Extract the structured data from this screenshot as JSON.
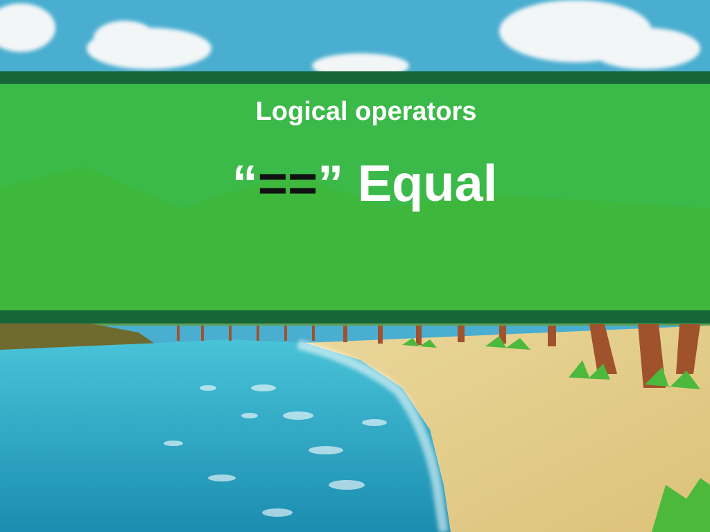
{
  "slide": {
    "subtitle": "Logical operators",
    "quote_open": "“",
    "operator": "==",
    "quote_close": "”",
    "operator_name": " Equal"
  },
  "colors": {
    "banner_green": "#3aba3a",
    "banner_stripe": "#17663a",
    "text_white": "#ffffff",
    "operator_black": "#111111",
    "sky": "#4aaed0",
    "sand": "#e6cf8a",
    "sea": "#2a9fc2"
  },
  "background": {
    "scene": "tropical-beach-illustration"
  }
}
